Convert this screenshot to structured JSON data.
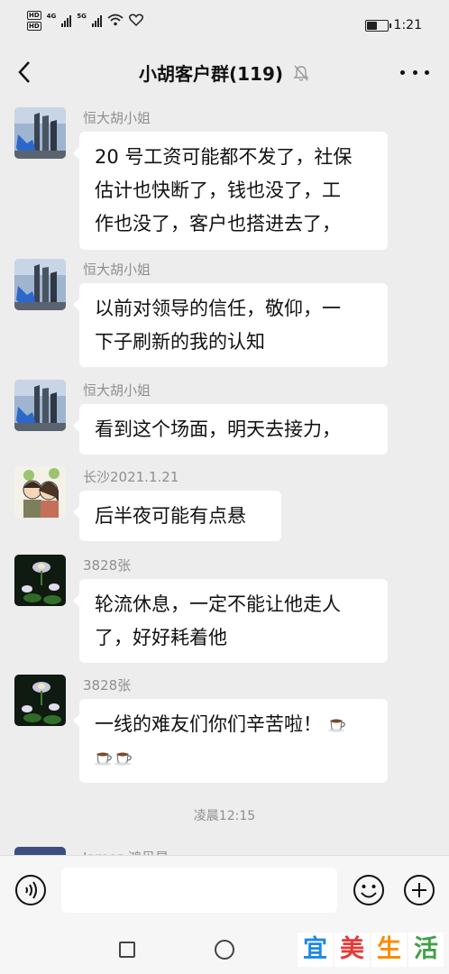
{
  "status_bar": {
    "hd_label": "HD",
    "net_labels": [
      "4G",
      "5G"
    ],
    "time": "1:21",
    "battery_level": 0.55
  },
  "header": {
    "title": "小胡客户群(119)",
    "icons": {
      "back": "back-arrow-icon",
      "mute": "mute-bell-icon",
      "more": "more-dots-icon"
    }
  },
  "messages": [
    {
      "sender": "恒大胡小姐",
      "avatar": "building-photo-avatar",
      "lines": [
        "20 号工资可能都不发了，社保",
        "估计也快断了，钱也没了，工",
        "作也没了，客户也搭进去了，"
      ]
    },
    {
      "sender": "恒大胡小姐",
      "avatar": "building-photo-avatar",
      "lines": [
        "以前对领导的信任，敬仰，一",
        "下子刷新的我的认知"
      ]
    },
    {
      "sender": "恒大胡小姐",
      "avatar": "building-photo-avatar",
      "lines": [
        "看到这个场面，明天去接力，"
      ]
    },
    {
      "sender": "长沙2021.1.21",
      "avatar": "cartoon-couple-avatar",
      "lines": [
        "后半夜可能有点悬"
      ]
    },
    {
      "sender": "3828张",
      "avatar": "flower-avatar",
      "lines": [
        "轮流休息，一定不能让他走人",
        "了，好好耗着他"
      ]
    },
    {
      "sender": "3828张",
      "avatar": "flower-avatar",
      "lines": [
        "一线的难友们你们辛苦啦！"
      ],
      "emoji": "coffee-cup-emoji",
      "emoji_count": 3
    },
    {
      "sender": "James 鸿贝星",
      "avatar": "building-photo-avatar",
      "lines": []
    }
  ],
  "time_divider": "凌晨12:15",
  "input_bar": {
    "placeholder": "",
    "icons": {
      "voice": "voice-icon",
      "emoji": "emoji-face-icon",
      "plus": "plus-icon"
    }
  },
  "system_nav": {
    "icons": [
      "recent-apps-square-icon",
      "home-circle-icon"
    ]
  },
  "watermark": {
    "chars": [
      "宜",
      "美",
      "生",
      "活"
    ],
    "colors": [
      "#1e88e5",
      "#e53935",
      "#fb8c00",
      "#43a047"
    ],
    "background": "#ffffff"
  },
  "colors": {
    "background": "#ededed",
    "bubble": "#ffffff",
    "sender_text": "#8f8f8f",
    "text": "#111111"
  }
}
